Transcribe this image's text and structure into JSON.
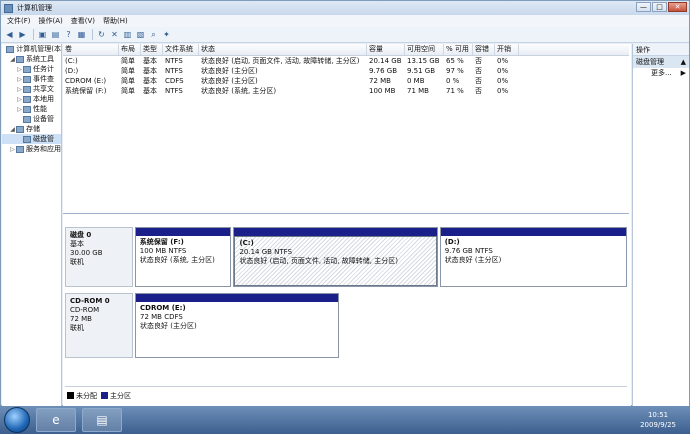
{
  "window": {
    "title": "计算机管理"
  },
  "window_buttons": {
    "min": "—",
    "max": "□",
    "close": "✕"
  },
  "menu": {
    "items": [
      "文件(F)",
      "操作(A)",
      "查看(V)",
      "帮助(H)"
    ]
  },
  "toolbar": {
    "icons": [
      "back-icon",
      "forward-icon",
      "folder-up-icon",
      "properties-icon",
      "help-icon",
      "view-icon",
      "refresh-icon",
      "delete-icon",
      "properties2-icon",
      "open-icon",
      "search-icon",
      "wizard-icon"
    ]
  },
  "tree": {
    "items": [
      {
        "label": "计算机管理(本",
        "exp": "",
        "level": 0
      },
      {
        "label": "系统工具",
        "exp": "◢",
        "level": 1
      },
      {
        "label": "任务计",
        "exp": "▷",
        "level": 2
      },
      {
        "label": "事件查",
        "exp": "▷",
        "level": 2
      },
      {
        "label": "共享文",
        "exp": "▷",
        "level": 2
      },
      {
        "label": "本地用",
        "exp": "▷",
        "level": 2
      },
      {
        "label": "性能",
        "exp": "▷",
        "level": 2
      },
      {
        "label": "设备管",
        "exp": "",
        "level": 2
      },
      {
        "label": "存储",
        "exp": "◢",
        "level": 1
      },
      {
        "label": "磁盘管",
        "exp": "",
        "level": 2,
        "selected": true
      },
      {
        "label": "服务和应用",
        "exp": "▷",
        "level": 1
      }
    ]
  },
  "volumes": {
    "headers": [
      "卷",
      "布局",
      "类型",
      "文件系统",
      "状态",
      "容量",
      "可用空间",
      "% 可用",
      "容错",
      "开销"
    ],
    "rows": [
      [
        "(C:)",
        "简单",
        "基本",
        "NTFS",
        "状态良好 (启动, 页面文件, 活动, 故障转储, 主分区)",
        "20.14 GB",
        "13.15 GB",
        "65 %",
        "否",
        "0%"
      ],
      [
        "(D:)",
        "简单",
        "基本",
        "NTFS",
        "状态良好 (主分区)",
        "9.76 GB",
        "9.51 GB",
        "97 %",
        "否",
        "0%"
      ],
      [
        "CDROM (E:)",
        "简单",
        "基本",
        "CDFS",
        "状态良好 (主分区)",
        "72 MB",
        "0 MB",
        "0 %",
        "否",
        "0%"
      ],
      [
        "系统保留 (F:)",
        "简单",
        "基本",
        "NTFS",
        "状态良好 (系统, 主分区)",
        "100 MB",
        "71 MB",
        "71 %",
        "否",
        "0%"
      ]
    ]
  },
  "disks": [
    {
      "name": "磁盘 0",
      "type": "基本",
      "size": "30.00 GB",
      "status": "联机",
      "partitions": [
        {
          "name": "系统保留   (F:)",
          "size": "100 MB NTFS",
          "status": "状态良好 (系统, 主分区)"
        },
        {
          "name": "(C:)",
          "size": "20.14 GB NTFS",
          "status": "状态良好 (启动, 页面文件, 活动, 故障转储, 主分区)",
          "selected": true
        },
        {
          "name": "(D:)",
          "size": "9.76 GB NTFS",
          "status": "状态良好 (主分区)"
        }
      ]
    },
    {
      "name": "CD-ROM 0",
      "type": "CD-ROM",
      "size": "72 MB",
      "status": "联机",
      "partitions": [
        {
          "name": "CDROM   (E:)",
          "size": "72 MB CDFS",
          "status": "状态良好 (主分区)"
        }
      ]
    }
  ],
  "legend": [
    {
      "label": "未分配",
      "color": "#000000"
    },
    {
      "label": "主分区",
      "color": "#1a1f8a"
    }
  ],
  "actions": {
    "header": "操作",
    "section": "磁盘管理",
    "more": "更多..."
  },
  "taskbar": {
    "time": "10:51",
    "date": "2009/9/25"
  }
}
